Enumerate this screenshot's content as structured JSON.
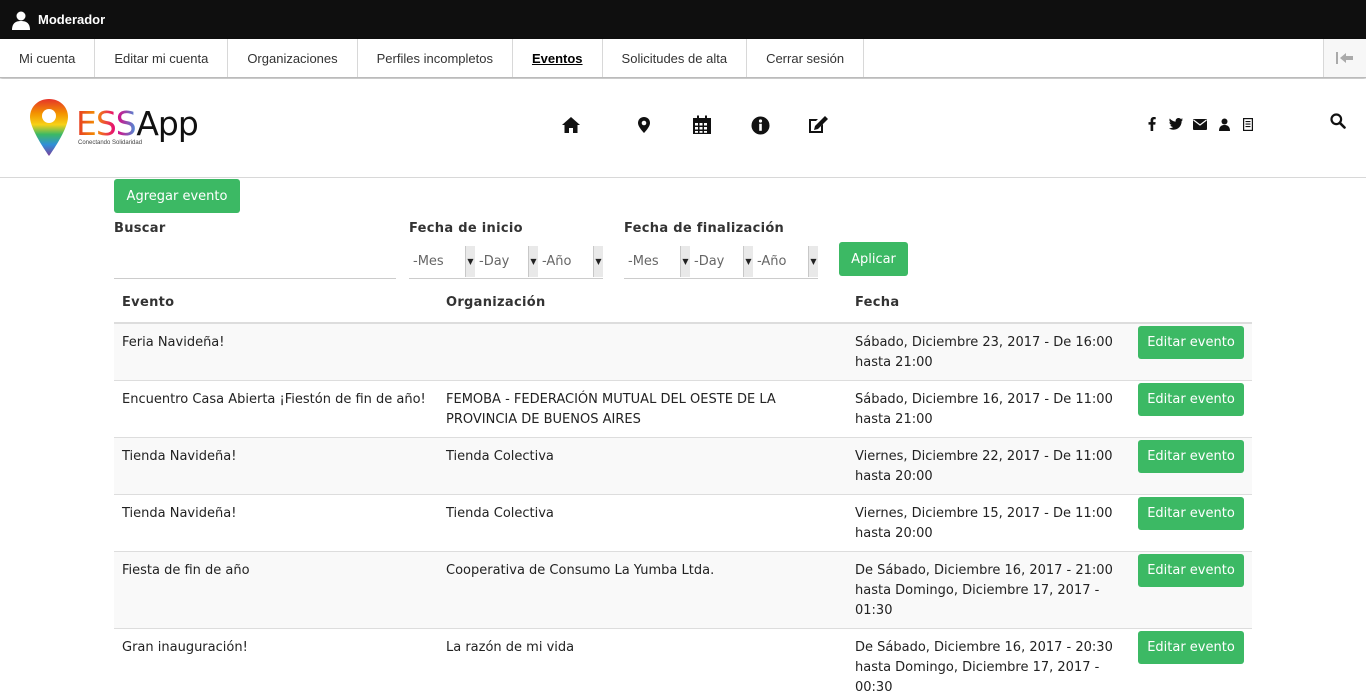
{
  "admin": {
    "user_label": "Moderador",
    "tabs": [
      {
        "label": "Mi cuenta"
      },
      {
        "label": "Editar mi cuenta"
      },
      {
        "label": "Organizaciones"
      },
      {
        "label": "Perfiles incompletos"
      },
      {
        "label": "Eventos",
        "active": true
      },
      {
        "label": "Solicitudes de alta"
      },
      {
        "label": "Cerrar sesión"
      }
    ]
  },
  "site": {
    "logo_ess": "ESS",
    "logo_app": "App",
    "tagline": "Conectando Solidaridad",
    "nav_icons": [
      "home-icon",
      "map-marker-icon",
      "calendar-icon",
      "info-icon",
      "edit-icon"
    ],
    "social_icons": [
      "facebook-icon",
      "twitter-icon",
      "envelope-icon",
      "user-icon",
      "document-icon"
    ]
  },
  "content": {
    "add_event_label": "Agregar evento",
    "search_label": "Buscar",
    "start_label": "Fecha de inicio",
    "end_label": "Fecha de finalización",
    "month_placeholder": "-Mes",
    "day_placeholder": "-Day",
    "year_placeholder": "-Año",
    "apply_label": "Aplicar",
    "accent_color": "#3cb964"
  },
  "table": {
    "headers": {
      "event": "Evento",
      "organization": "Organización",
      "date": "Fecha"
    },
    "edit_label": "Editar evento",
    "rows": [
      {
        "event": "Feria Navideña!",
        "organization": "",
        "date": "Sábado, Diciembre 23, 2017 - De 16:00 hasta 21:00"
      },
      {
        "event": "Encuentro Casa Abierta ¡Fiestón de fin de año!",
        "organization": "FEMOBA - FEDERACIÓN MUTUAL DEL OESTE DE LA PROVINCIA DE BUENOS AIRES",
        "date": "Sábado, Diciembre 16, 2017 - De 11:00 hasta 21:00"
      },
      {
        "event": "Tienda Navideña!",
        "organization": "Tienda Colectiva",
        "date": "Viernes, Diciembre 22, 2017 - De 11:00 hasta 20:00"
      },
      {
        "event": "Tienda Navideña!",
        "organization": "Tienda Colectiva",
        "date": "Viernes, Diciembre 15, 2017 - De 11:00 hasta 20:00"
      },
      {
        "event": "Fiesta de fin de año",
        "organization": "Cooperativa de Consumo La Yumba Ltda.",
        "date": "De Sábado, Diciembre 16, 2017 - 21:00 hasta Domingo, Diciembre 17, 2017 - 01:30"
      },
      {
        "event": "Gran inauguración!",
        "organization": "La razón de mi vida",
        "date": "De Sábado, Diciembre 16, 2017 - 20:30 hasta Domingo, Diciembre 17, 2017 - 00:30"
      }
    ]
  }
}
